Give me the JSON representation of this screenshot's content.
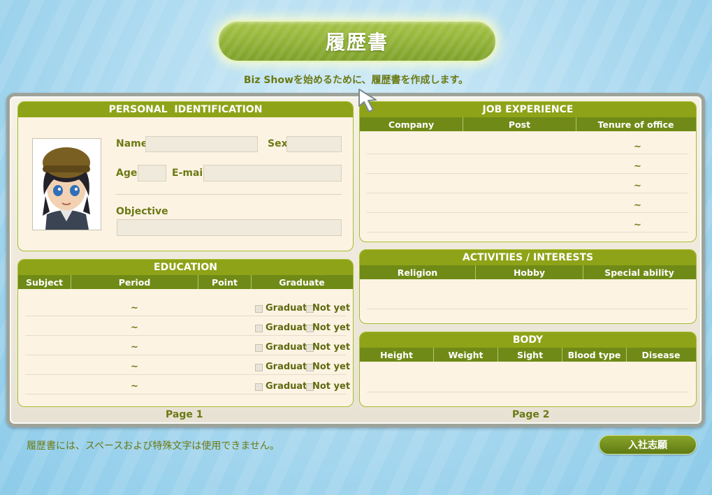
{
  "title": "履歴書",
  "subtitle": "Biz Showを始めるために、履歴書を作成します。",
  "personal": {
    "header": "PERSONAL  IDENTIFICATION",
    "name_label": "Name",
    "sex_label": "Sex",
    "age_label": "Age",
    "email_label": "E-mail",
    "objective_label": "Objective"
  },
  "education": {
    "header": "EDUCATION",
    "columns": [
      "Subject",
      "Period",
      "Point",
      "Graduate"
    ],
    "rows": [
      {
        "period": "~",
        "graduate_label": "Graduate",
        "not_yet_label": "Not yet"
      },
      {
        "period": "~",
        "graduate_label": "Graduate",
        "not_yet_label": "Not yet"
      },
      {
        "period": "~",
        "graduate_label": "Graduate",
        "not_yet_label": "Not yet"
      },
      {
        "period": "~",
        "graduate_label": "Graduate",
        "not_yet_label": "Not yet"
      },
      {
        "period": "~",
        "graduate_label": "Graduate",
        "not_yet_label": "Not yet"
      }
    ]
  },
  "job": {
    "header": "JOB EXPERIENCE",
    "columns": [
      "Company",
      "Post",
      "Tenure of office"
    ],
    "rows": [
      "~",
      "~",
      "~",
      "~",
      "~"
    ]
  },
  "activities": {
    "header": "ACTIVITIES / INTERESTS",
    "columns": [
      "Religion",
      "Hobby",
      "Special ability"
    ]
  },
  "body": {
    "header": "BODY",
    "columns": [
      "Height",
      "Weight",
      "Sight",
      "Blood type",
      "Disease"
    ]
  },
  "pages": {
    "page1": "Page 1",
    "page2": "Page 2"
  },
  "footer_note": "履歴書には、スペースおよび特殊文字は使用できません。",
  "apply_button": "入社志願",
  "colors": {
    "accent": "#8ea317",
    "column_header": "#6f8a17",
    "text": "#6b7a14",
    "background": "#a9d8ef"
  }
}
